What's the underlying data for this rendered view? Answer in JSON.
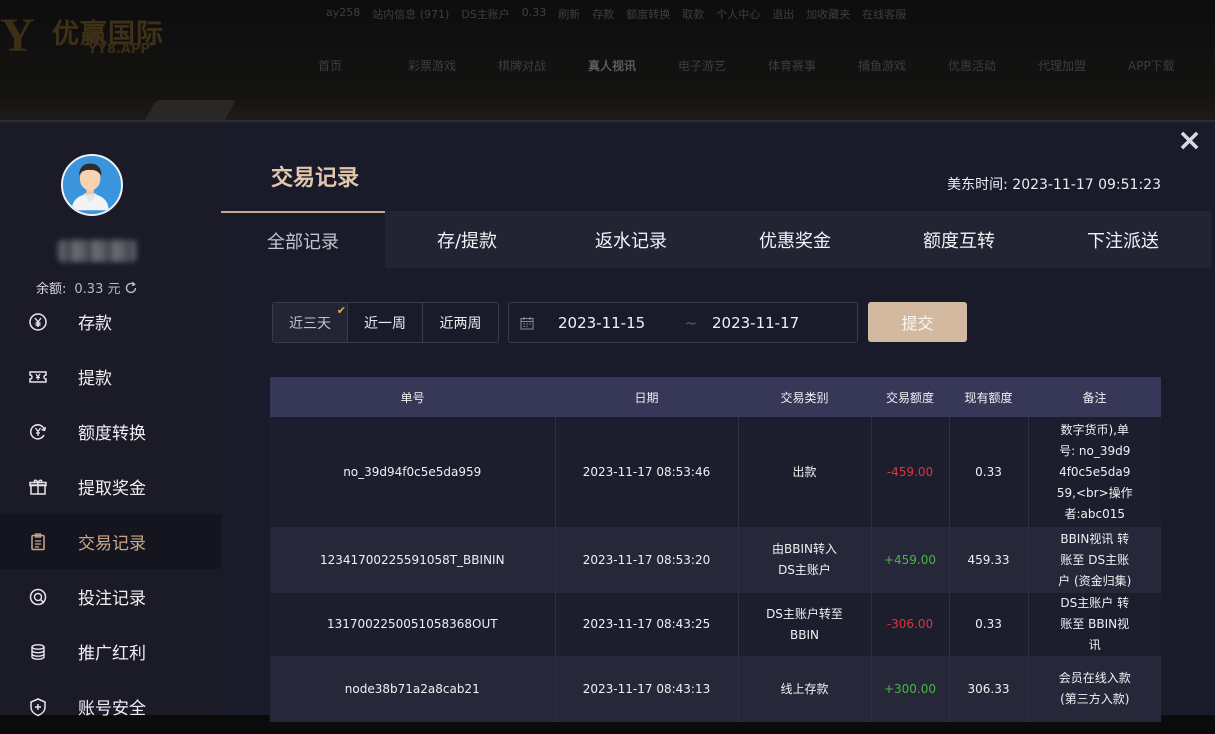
{
  "site": {
    "logo_mark": "Y",
    "logo_cn": "优赢国际",
    "logo_en": "YY8.APP",
    "topbar": [
      "ay258",
      "站内信息 (971)",
      "DS主账户",
      "0.33",
      "刷新",
      "存款",
      "额度转换",
      "取款",
      "个人中心",
      "退出",
      "加收藏夹",
      "在线客服"
    ],
    "nav": [
      "首页",
      "彩票游戏",
      "棋牌对战",
      "真人视讯",
      "电子游艺",
      "体育赛事",
      "捕鱼游戏",
      "优惠活动",
      "代理加盟",
      "APP下载"
    ],
    "nav_active": "真人视讯"
  },
  "sidebar": {
    "balance_label": "余额:",
    "balance_value": "0.33 元",
    "items": [
      {
        "label": "存款",
        "icon": "yen-circle-icon"
      },
      {
        "label": "提款",
        "icon": "ticket-icon"
      },
      {
        "label": "额度转换",
        "icon": "currency-transfer-icon"
      },
      {
        "label": "提取奖金",
        "icon": "gift-icon"
      },
      {
        "label": "交易记录",
        "icon": "clipboard-icon"
      },
      {
        "label": "投注记录",
        "icon": "bet-record-icon"
      },
      {
        "label": "推广红利",
        "icon": "coin-stack-icon"
      },
      {
        "label": "账号安全",
        "icon": "shield-icon"
      }
    ],
    "active_item": "交易记录"
  },
  "main": {
    "title": "交易记录",
    "et_time_label": "美东时间:",
    "et_time_value": "2023-11-17 09:51:23",
    "tabs": [
      "全部记录",
      "存/提款",
      "返水记录",
      "优惠奖金",
      "额度互转",
      "下注派送"
    ],
    "active_tab": "全部记录",
    "ranges": [
      "近三天",
      "近一周",
      "近两周"
    ],
    "active_range": "近三天",
    "date_start": "2023-11-15",
    "date_separator": "~",
    "date_end": "2023-11-17",
    "submit_label": "提交"
  },
  "table": {
    "columns": [
      "单号",
      "日期",
      "交易类别",
      "交易额度",
      "现有额度",
      "备注"
    ],
    "rows": [
      {
        "id": "no_39d94f0c5e5da959",
        "date": "2023-11-17 08:53:46",
        "type": "出款",
        "amount": "-459.00",
        "sign": "neg",
        "balance": "0.33",
        "remark": "数字货币),单号: no_39d94f0c5e5da959,<br>操作者:abc015"
      },
      {
        "id": "12341700225591058T_BBININ",
        "date": "2023-11-17 08:53:20",
        "type": "由BBIN转入DS主账户",
        "amount": "+459.00",
        "sign": "pos",
        "balance": "459.33",
        "remark": "BBIN视讯 转账至 DS主账户 (资金归集)"
      },
      {
        "id": "1317002250051058368OUT",
        "date": "2023-11-17 08:43:25",
        "type": "DS主账户转至BBIN",
        "amount": "-306.00",
        "sign": "neg",
        "balance": "0.33",
        "remark": "DS主账户 转账至 BBIN视讯"
      },
      {
        "id": "node38b71a2a8cab21",
        "date": "2023-11-17 08:43:13",
        "type": "线上存款",
        "amount": "+300.00",
        "sign": "pos",
        "balance": "306.33",
        "remark": "会员在线入款 (第三方入款)"
      }
    ]
  },
  "colors": {
    "accent_gold": "#c9a98a",
    "submit_bg": "#d2b9a0",
    "negative": "#d9363e",
    "positive": "#4bb548",
    "header_row": "#373858"
  }
}
